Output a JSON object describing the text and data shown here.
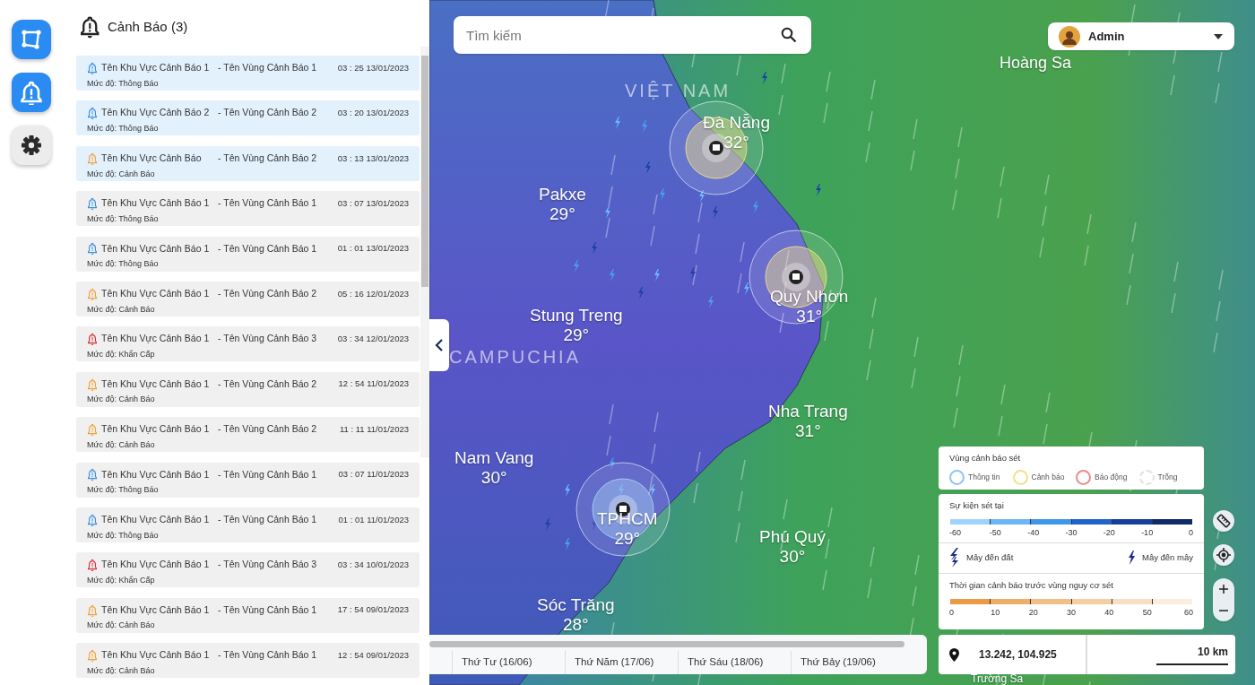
{
  "rail": [
    {
      "kind": "area",
      "active": true
    },
    {
      "kind": "alerts",
      "active": true
    },
    {
      "kind": "settings",
      "active": false
    }
  ],
  "alerts_panel": {
    "title": "Cảnh Báo (3)",
    "items": [
      {
        "area": "Tên Khu Vực Cảnh Báo 1",
        "zone": "- Tên Vùng Cảnh Báo 1",
        "time": "03 : 25 13/01/2023",
        "level_text": "Mức độ: Thông Báo",
        "kind": "info",
        "highlighted": true
      },
      {
        "area": "Tên Khu Vực Cảnh Báo 2",
        "zone": "- Tên Vùng Cảnh Báo 2",
        "time": "03 : 20 13/01/2023",
        "level_text": "Mức độ: Thông Báo",
        "kind": "info",
        "highlighted": true
      },
      {
        "area": "Tên Khu Vực Cảnh Báo",
        "zone": "- Tên Vùng Cảnh Báo 2",
        "time": "03 : 13 13/01/2023",
        "level_text": "Mức độ: Cảnh Báo",
        "kind": "warning",
        "highlighted": true
      },
      {
        "area": "Tên Khu Vực Cảnh Báo 1",
        "zone": "- Tên Vùng Cảnh Báo 1",
        "time": "03 : 07 13/01/2023",
        "level_text": "Mức độ: Thông Báo",
        "kind": "info",
        "highlighted": false
      },
      {
        "area": "Tên Khu Vực Cảnh Báo 1",
        "zone": "- Tên Vùng Cảnh Báo 1",
        "time": "01 : 01 13/01/2023",
        "level_text": "Mức độ: Thông Báo",
        "kind": "info",
        "highlighted": false
      },
      {
        "area": "Tên Khu Vực Cảnh Báo 1",
        "zone": "- Tên Vùng Cảnh Báo 2",
        "time": "05 : 16 12/01/2023",
        "level_text": "Mức độ: Cảnh Báo",
        "kind": "warning",
        "highlighted": false
      },
      {
        "area": "Tên Khu Vực Cảnh Báo 1",
        "zone": "- Tên Vùng Cảnh Báo 3",
        "time": "03 : 34 12/01/2023",
        "level_text": "Mức độ: Khẩn Cấp",
        "kind": "emergency",
        "highlighted": false
      },
      {
        "area": "Tên Khu Vực Cảnh Báo 1",
        "zone": "- Tên Vùng Cảnh Báo 2",
        "time": "12 : 54 11/01/2023",
        "level_text": "Mức độ: Cảnh Báo",
        "kind": "warning",
        "highlighted": false
      },
      {
        "area": "Tên Khu Vực Cảnh Báo 1",
        "zone": "- Tên Vùng Cảnh Báo 2",
        "time": "11 : 11 11/01/2023",
        "level_text": "Mức độ: Cảnh Báo",
        "kind": "warning",
        "highlighted": false
      },
      {
        "area": "Tên Khu Vực Cảnh Báo 1",
        "zone": "- Tên Vùng Cảnh Báo 1",
        "time": "03 : 07 11/01/2023",
        "level_text": "Mức độ: Thông Báo",
        "kind": "info",
        "highlighted": false
      },
      {
        "area": "Tên Khu Vực Cảnh Báo 1",
        "zone": "- Tên Vùng Cảnh Báo 1",
        "time": "01 : 01 11/01/2023",
        "level_text": "Mức độ: Thông Báo",
        "kind": "info",
        "highlighted": false
      },
      {
        "area": "Tên Khu Vực Cảnh Báo 1",
        "zone": "- Tên Vùng Cảnh Báo 3",
        "time": "03 : 34 10/01/2023",
        "level_text": "Mức độ: Khẩn Cấp",
        "kind": "emergency",
        "highlighted": false
      },
      {
        "area": "Tên Khu Vực Cảnh Báo 1",
        "zone": "- Tên Vùng Cảnh Báo 1",
        "time": "17 : 54 09/01/2023",
        "level_text": "Mức độ: Cảnh Báo",
        "kind": "warning",
        "highlighted": false
      },
      {
        "area": "Tên Khu Vực Cảnh Báo 1",
        "zone": "- Tên Vùng Cảnh Báo 1",
        "time": "12 : 54 09/01/2023",
        "level_text": "Mức độ: Cảnh Báo",
        "kind": "warning",
        "highlighted": false
      }
    ]
  },
  "search": {
    "placeholder": "Tìm kiếm"
  },
  "user": {
    "name": "Admin"
  },
  "map": {
    "labels": [
      {
        "kind": "country",
        "name": "VIỆT NAM"
      },
      {
        "kind": "place",
        "name": "Hoàng Sa"
      },
      {
        "kind": "city",
        "name": "Đà Nẵng",
        "temp": "32°"
      },
      {
        "kind": "city",
        "name": "Pakxe",
        "temp": "29°"
      },
      {
        "kind": "city",
        "name": "Quy Nhơn",
        "temp": "31°"
      },
      {
        "kind": "city",
        "name": "Stung Treng",
        "temp": "29°"
      },
      {
        "kind": "country",
        "name": "CAMPUCHIA"
      },
      {
        "kind": "city",
        "name": "Nha Trang",
        "temp": "31°"
      },
      {
        "kind": "city",
        "name": "Nam Vang",
        "temp": "30°"
      },
      {
        "kind": "city",
        "name": "TPHCM",
        "temp": "29°"
      },
      {
        "kind": "city",
        "name": "Phú Quý",
        "temp": "30°"
      },
      {
        "kind": "city",
        "name": "Sóc Trăng",
        "temp": "28°"
      },
      {
        "kind": "place",
        "name": "Trường Sa"
      }
    ],
    "zones": [
      {
        "kind": "warning"
      },
      {
        "kind": "warning"
      },
      {
        "kind": "info"
      }
    ]
  },
  "legend": {
    "zone_title": "Vùng cảnh báo sét",
    "zone_types": [
      {
        "label": "Thông tin",
        "color": "#90c4f5"
      },
      {
        "label": "Cảnh báo",
        "color": "#f3e08a"
      },
      {
        "label": "Báo động",
        "color": "#ef8a8a"
      },
      {
        "label": "Trống",
        "color": "#e0e0e0"
      }
    ],
    "events_title": "Sự kiện sét tại",
    "events_ticks": [
      "-60",
      "-50",
      "-40",
      "-30",
      "-20",
      "-10",
      "0"
    ],
    "strike_types": [
      {
        "kind": "ground",
        "label": "Mây đến đất"
      },
      {
        "kind": "cloud",
        "label": "Mây đến mây"
      }
    ],
    "lead_title": "Thời gian cảnh báo trước vùng nguy cơ sét",
    "lead_ticks": [
      "0",
      "10",
      "20",
      "30",
      "40",
      "50",
      "60"
    ]
  },
  "coordinates": "13.242, 104.925",
  "scale": "10 km",
  "timeline": {
    "days": [
      "Thứ Tư (16/06)",
      "Thứ Năm (17/06)",
      "Thứ Sáu (18/06)",
      "Thứ Bảy (19/06)"
    ]
  }
}
